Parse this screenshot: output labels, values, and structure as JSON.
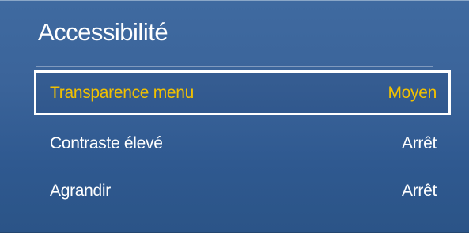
{
  "menu": {
    "title": "Accessibilité",
    "colors": {
      "background": "#3b649a",
      "selected_text": "#f2c100",
      "text": "#ffffff",
      "selected_border": "#ffffff"
    },
    "items": [
      {
        "label": "Transparence menu",
        "value": "Moyen",
        "selected": true
      },
      {
        "label": "Contraste élevé",
        "value": "Arrêt",
        "selected": false
      },
      {
        "label": "Agrandir",
        "value": "Arrêt",
        "selected": false
      }
    ]
  }
}
